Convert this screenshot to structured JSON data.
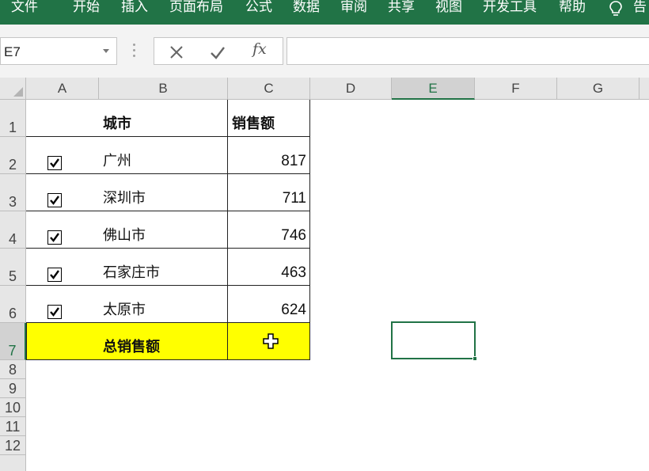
{
  "ribbon": {
    "tabs": [
      "文件",
      "开始",
      "插入",
      "页面布局",
      "公式",
      "数据",
      "审阅",
      "共享",
      "视图",
      "开发工具",
      "帮助"
    ],
    "tell_me": "告"
  },
  "formula_bar": {
    "name_box": "E7",
    "fx_label": "fx",
    "formula": ""
  },
  "columns": [
    "A",
    "B",
    "C",
    "D",
    "E",
    "F",
    "G"
  ],
  "selected_column": "E",
  "rows": [
    "1",
    "2",
    "3",
    "4",
    "5",
    "6",
    "7",
    "8",
    "9",
    "10",
    "11",
    "12"
  ],
  "selected_row": "7",
  "table": {
    "header": {
      "city": "城市",
      "sales": "销售额"
    },
    "items": [
      {
        "checked": true,
        "city": "广州",
        "sales": "817"
      },
      {
        "checked": true,
        "city": "深圳市",
        "sales": "711"
      },
      {
        "checked": true,
        "city": "佛山市",
        "sales": "746"
      },
      {
        "checked": true,
        "city": "石家庄市",
        "sales": "463"
      },
      {
        "checked": true,
        "city": "太原市",
        "sales": "624"
      }
    ],
    "total_label": "总销售额"
  },
  "colors": {
    "ribbon": "#217346",
    "highlight": "#ffff00",
    "selection": "#217346"
  }
}
